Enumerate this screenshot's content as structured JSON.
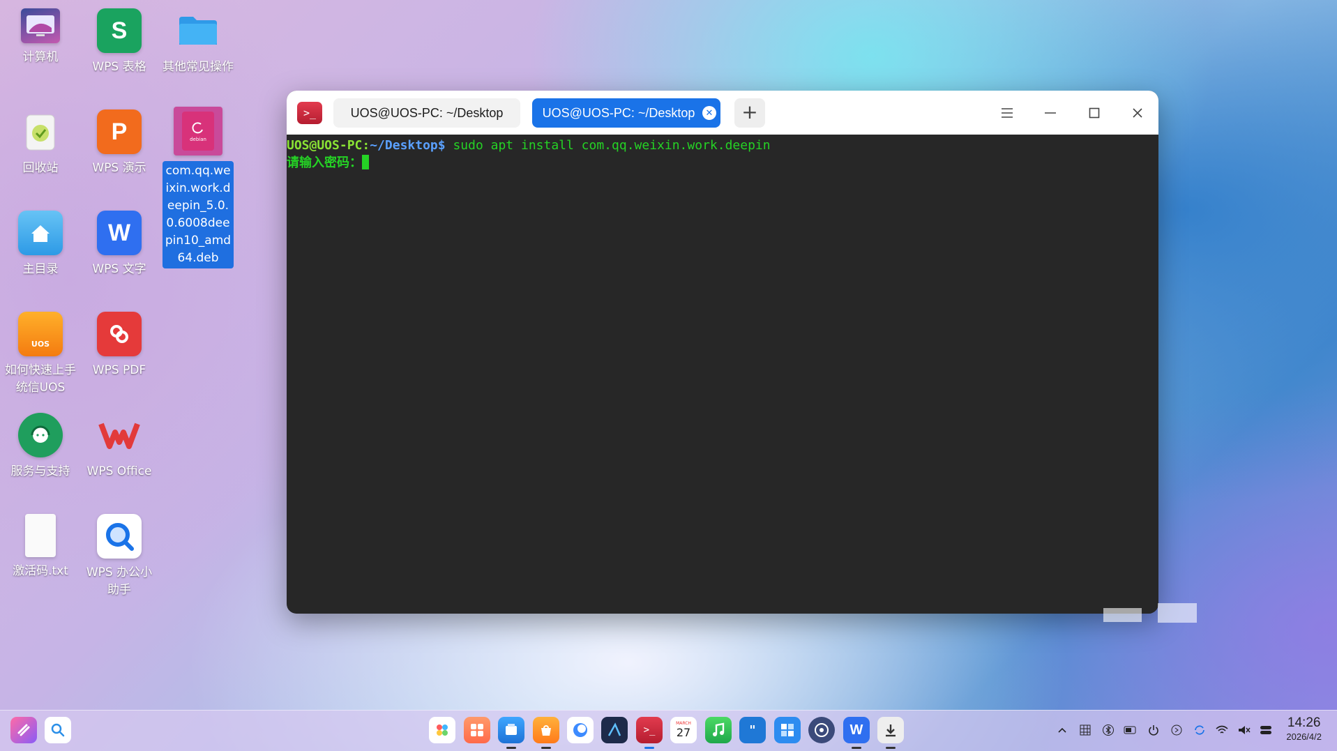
{
  "desktop": {
    "icons": [
      {
        "label": "计算机",
        "icon": "computer-icon"
      },
      {
        "label": "WPS 表格",
        "icon": "wps-spreadsheet-icon",
        "glyph": "S",
        "color": "#1aa35f"
      },
      {
        "label": "其他常见操作",
        "icon": "folder-icon"
      },
      {
        "label": "回收站",
        "icon": "trash-icon"
      },
      {
        "label": "WPS 演示",
        "icon": "wps-presentation-icon",
        "glyph": "P",
        "color": "#f26b1d"
      },
      {
        "label": "com.qq.weixin.work.deepin_5.0.0.6008deepin10_amd64.deb",
        "icon": "deb-package-icon",
        "badge": "debian"
      },
      {
        "label": "主目录",
        "icon": "home-folder-icon"
      },
      {
        "label": "WPS 文字",
        "icon": "wps-writer-icon",
        "glyph": "W",
        "color": "#2f6ff0"
      },
      {
        "label": "如何快速上手统信UOS",
        "icon": "uos-guide-icon",
        "badge": "UOS"
      },
      {
        "label": "WPS PDF",
        "icon": "wps-pdf-icon",
        "color": "#e53a3a"
      },
      {
        "label": "服务与支持",
        "icon": "support-icon"
      },
      {
        "label": "WPS Office",
        "icon": "wps-office-icon"
      },
      {
        "label": "激活码.txt",
        "icon": "text-file-icon"
      },
      {
        "label": "WPS 办公小助手",
        "icon": "wps-assistant-icon"
      }
    ]
  },
  "terminal": {
    "tabs": [
      {
        "label": "UOS@UOS-PC: ~/Desktop",
        "active": false
      },
      {
        "label": "UOS@UOS-PC: ~/Desktop",
        "active": true
      }
    ],
    "new_tab": "+",
    "lines": {
      "user_host": "UOS@UOS-PC",
      "sep": ":",
      "path": "~/Desktop",
      "prompt_symbol": "$",
      "command": " sudo apt install com.qq.weixin.work.deepin",
      "password_prompt": "请输入密码："
    }
  },
  "taskbar": {
    "clock_time": "14:26",
    "clock_date": "2026/4/2",
    "calendar_day": "27",
    "calendar_month": "MARCH"
  },
  "colors": {
    "accent": "#1a73e8",
    "terminal_bg": "#272727",
    "terminal_green": "#25d225",
    "terminal_path": "#5aa0ff"
  }
}
